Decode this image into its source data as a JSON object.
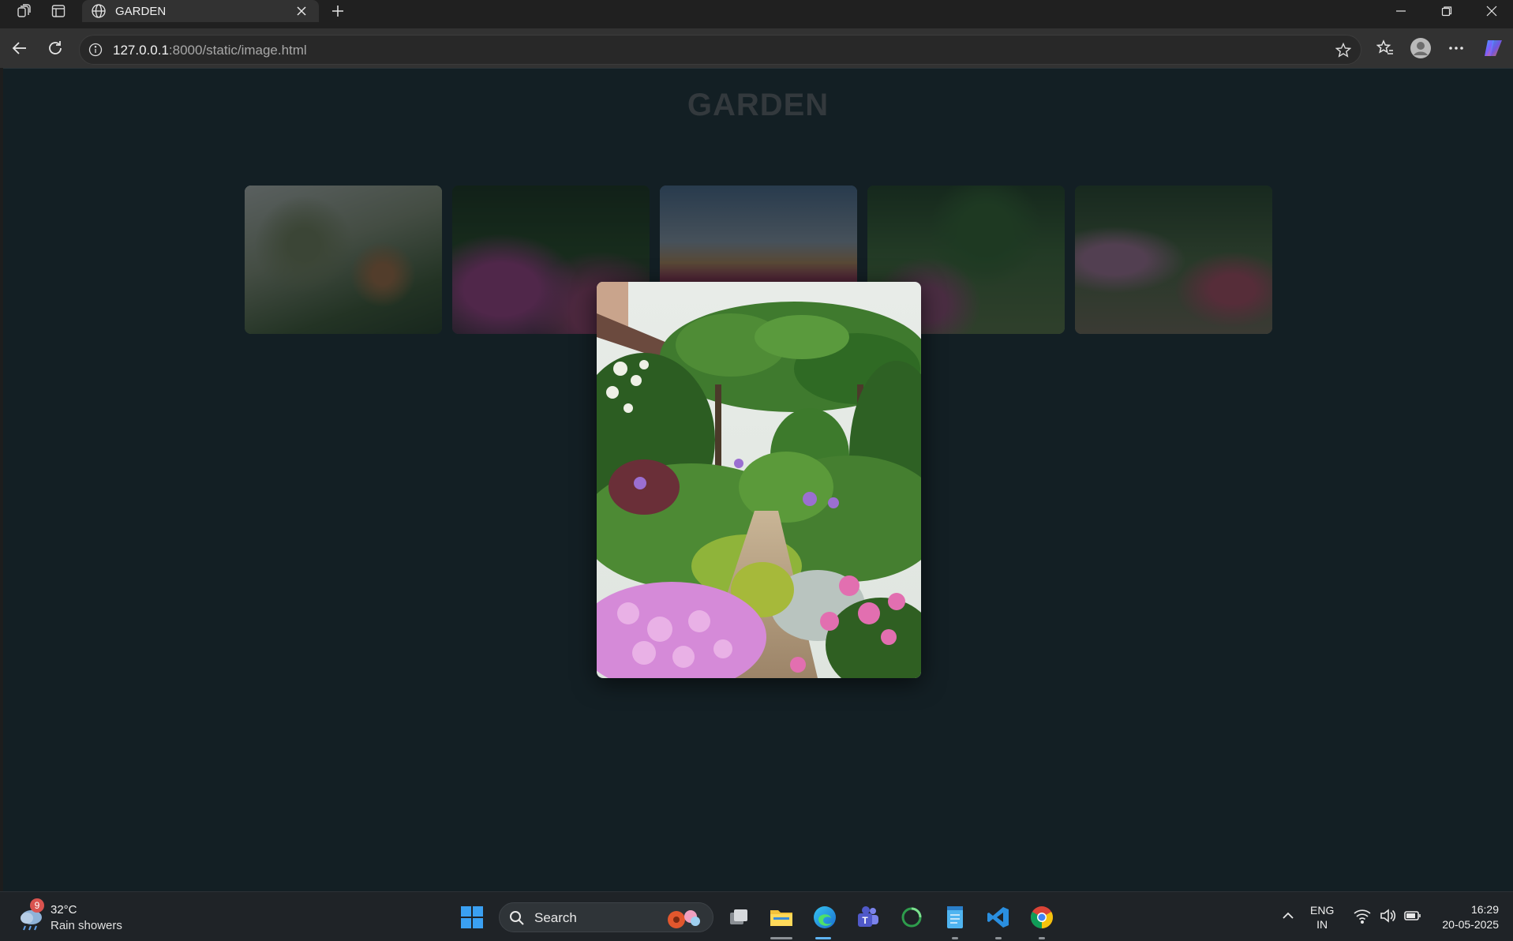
{
  "browser": {
    "tab_title": "GARDEN",
    "url_host": "127.0.0.1",
    "url_rest": ":8000/static/image.html"
  },
  "page": {
    "title": "GARDEN",
    "thumbnails": [
      {
        "subject": "potted plants garden"
      },
      {
        "subject": "hydrangea bushes"
      },
      {
        "subject": "tulip field at sunset"
      },
      {
        "subject": "garden path with shrubs"
      },
      {
        "subject": "stone path with roses"
      }
    ],
    "lightbox": {
      "subject": "cottage garden path with pergola and pink flowers"
    }
  },
  "taskbar": {
    "weather": {
      "badge": "9",
      "temperature": "32°C",
      "condition": "Rain showers"
    },
    "search_placeholder": "Search",
    "language": {
      "line1": "ENG",
      "line2": "IN"
    },
    "time": "16:29",
    "date": "20-05-2025"
  }
}
